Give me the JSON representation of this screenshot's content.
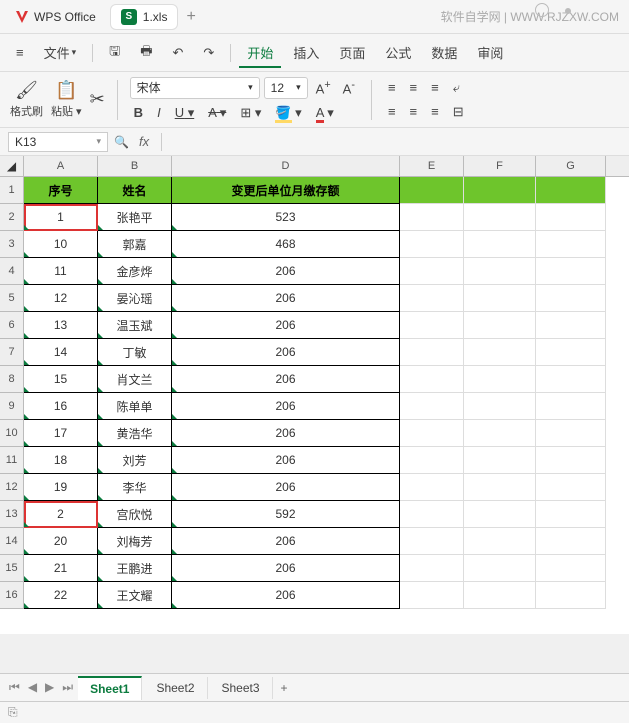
{
  "titlebar": {
    "app": "WPS Office",
    "tab": "1.xls",
    "watermark": "软件自学网 | WWW.RJZXW.COM"
  },
  "menubar": {
    "file": "文件",
    "start": "开始",
    "insert": "插入",
    "page": "页面",
    "formula": "公式",
    "data": "数据",
    "review": "审阅"
  },
  "toolbar": {
    "formatbrush": "格式刷",
    "paste": "粘贴",
    "font": "宋体",
    "size": "12",
    "bold": "B",
    "italic": "I",
    "underline": "U",
    "strike": "A"
  },
  "namebox": {
    "cell": "K13",
    "fx": "fx"
  },
  "columns": [
    "A",
    "B",
    "D",
    "E",
    "F",
    "G"
  ],
  "header": {
    "a": "序号",
    "b": "姓名",
    "d": "变更后单位月缴存额"
  },
  "rows": [
    {
      "n": "1",
      "a": "序号",
      "b": "姓名",
      "d": "变更后单位月缴存额",
      "hdr": true
    },
    {
      "n": "2",
      "a": "1",
      "b": "张艳平",
      "d": "523",
      "hl": true
    },
    {
      "n": "3",
      "a": "10",
      "b": "郭嘉",
      "d": "468"
    },
    {
      "n": "4",
      "a": "11",
      "b": "金彦烨",
      "d": "206"
    },
    {
      "n": "5",
      "a": "12",
      "b": "晏沁瑶",
      "d": "206"
    },
    {
      "n": "6",
      "a": "13",
      "b": "温玉斌",
      "d": "206"
    },
    {
      "n": "7",
      "a": "14",
      "b": "丁敏",
      "d": "206"
    },
    {
      "n": "8",
      "a": "15",
      "b": "肖文兰",
      "d": "206"
    },
    {
      "n": "9",
      "a": "16",
      "b": "陈单单",
      "d": "206"
    },
    {
      "n": "10",
      "a": "17",
      "b": "黄浩华",
      "d": "206"
    },
    {
      "n": "11",
      "a": "18",
      "b": "刘芳",
      "d": "206"
    },
    {
      "n": "12",
      "a": "19",
      "b": "李华",
      "d": "206"
    },
    {
      "n": "13",
      "a": "2",
      "b": "宫欣悦",
      "d": "592",
      "hl": true
    },
    {
      "n": "14",
      "a": "20",
      "b": "刘梅芳",
      "d": "206"
    },
    {
      "n": "15",
      "a": "21",
      "b": "王鹏进",
      "d": "206"
    },
    {
      "n": "16",
      "a": "22",
      "b": "王文耀",
      "d": "206"
    }
  ],
  "sheets": {
    "s1": "Sheet1",
    "s2": "Sheet2",
    "s3": "Sheet3"
  }
}
